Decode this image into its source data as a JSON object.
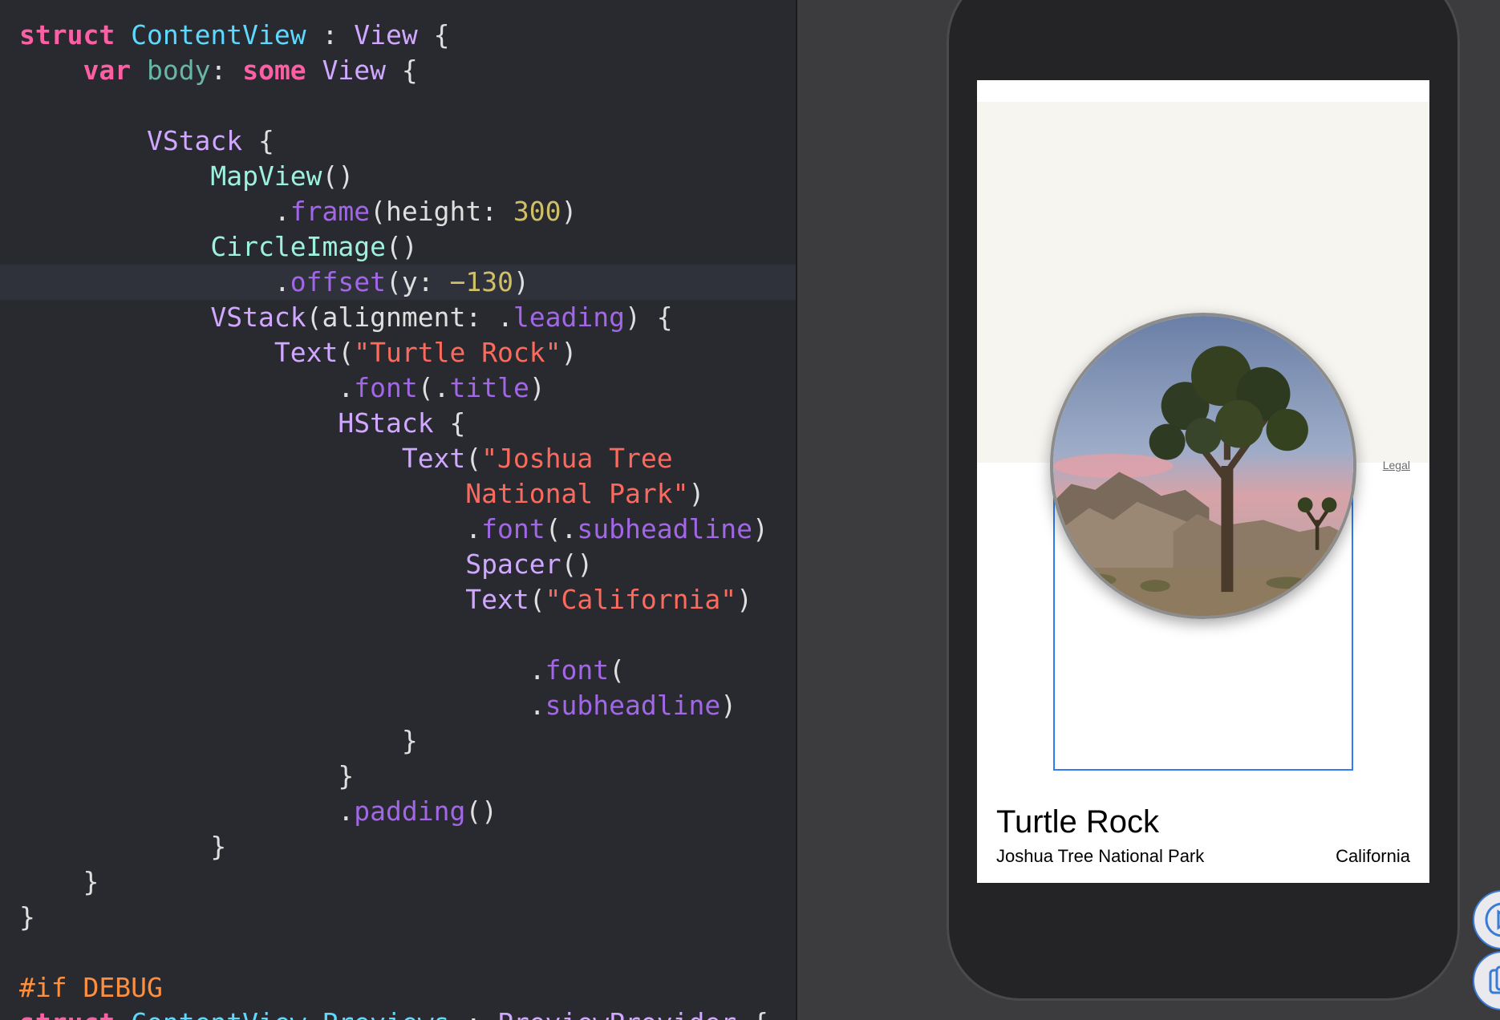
{
  "editor": {
    "lines": [
      [
        {
          "t": "kw",
          "v": "struct"
        },
        {
          "t": "plain",
          "v": " "
        },
        {
          "t": "type",
          "v": "ContentView"
        },
        {
          "t": "plain",
          "v": " : "
        },
        {
          "t": "sys",
          "v": "View"
        },
        {
          "t": "plain",
          "v": " {"
        }
      ],
      [
        {
          "t": "plain",
          "v": "    "
        },
        {
          "t": "kw",
          "v": "var"
        },
        {
          "t": "plain",
          "v": " "
        },
        {
          "t": "var",
          "v": "body"
        },
        {
          "t": "plain",
          "v": ": "
        },
        {
          "t": "kw",
          "v": "some"
        },
        {
          "t": "plain",
          "v": " "
        },
        {
          "t": "sys",
          "v": "View"
        },
        {
          "t": "plain",
          "v": " {"
        }
      ],
      [
        {
          "t": "plain",
          "v": ""
        }
      ],
      [
        {
          "t": "plain",
          "v": "        "
        },
        {
          "t": "sys",
          "v": "VStack"
        },
        {
          "t": "plain",
          "v": " {"
        }
      ],
      [
        {
          "t": "plain",
          "v": "            "
        },
        {
          "t": "fn",
          "v": "MapView"
        },
        {
          "t": "plain",
          "v": "()"
        }
      ],
      [
        {
          "t": "plain",
          "v": "                ."
        },
        {
          "t": "prop",
          "v": "frame"
        },
        {
          "t": "plain",
          "v": "(height: "
        },
        {
          "t": "num",
          "v": "300"
        },
        {
          "t": "plain",
          "v": ")"
        }
      ],
      [
        {
          "t": "plain",
          "v": "            "
        },
        {
          "t": "fn",
          "v": "CircleImage"
        },
        {
          "t": "plain",
          "v": "()"
        }
      ],
      [
        {
          "t": "plain",
          "v": "                ."
        },
        {
          "t": "prop",
          "v": "offset"
        },
        {
          "t": "plain",
          "v": "(y: "
        },
        {
          "t": "num",
          "v": "−130"
        },
        {
          "t": "plain",
          "v": ")"
        }
      ],
      [
        {
          "t": "plain",
          "v": "            "
        },
        {
          "t": "sys",
          "v": "VStack"
        },
        {
          "t": "plain",
          "v": "(alignment: ."
        },
        {
          "t": "prop",
          "v": "leading"
        },
        {
          "t": "plain",
          "v": ") {"
        }
      ],
      [
        {
          "t": "plain",
          "v": "                "
        },
        {
          "t": "sys",
          "v": "Text"
        },
        {
          "t": "plain",
          "v": "("
        },
        {
          "t": "str",
          "v": "\"Turtle Rock\""
        },
        {
          "t": "plain",
          "v": ")"
        }
      ],
      [
        {
          "t": "plain",
          "v": "                    ."
        },
        {
          "t": "prop",
          "v": "font"
        },
        {
          "t": "plain",
          "v": "(."
        },
        {
          "t": "prop",
          "v": "title"
        },
        {
          "t": "plain",
          "v": ")"
        }
      ],
      [
        {
          "t": "plain",
          "v": "                    "
        },
        {
          "t": "sys",
          "v": "HStack"
        },
        {
          "t": "plain",
          "v": " {"
        }
      ],
      [
        {
          "t": "plain",
          "v": "                        "
        },
        {
          "t": "sys",
          "v": "Text"
        },
        {
          "t": "plain",
          "v": "("
        },
        {
          "t": "str",
          "v": "\"Joshua Tree"
        }
      ],
      [
        {
          "t": "plain",
          "v": "                            "
        },
        {
          "t": "str",
          "v": "National Park\""
        },
        {
          "t": "plain",
          "v": ")"
        }
      ],
      [
        {
          "t": "plain",
          "v": "                            ."
        },
        {
          "t": "prop",
          "v": "font"
        },
        {
          "t": "plain",
          "v": "(."
        },
        {
          "t": "prop",
          "v": "subheadline"
        },
        {
          "t": "plain",
          "v": ")"
        }
      ],
      [
        {
          "t": "plain",
          "v": "                            "
        },
        {
          "t": "sys",
          "v": "Spacer"
        },
        {
          "t": "plain",
          "v": "()"
        }
      ],
      [
        {
          "t": "plain",
          "v": "                            "
        },
        {
          "t": "sys",
          "v": "Text"
        },
        {
          "t": "plain",
          "v": "("
        },
        {
          "t": "str",
          "v": "\"California\""
        },
        {
          "t": "plain",
          "v": ")"
        }
      ],
      [
        {
          "t": "plain",
          "v": ""
        }
      ],
      [
        {
          "t": "plain",
          "v": "                                ."
        },
        {
          "t": "prop",
          "v": "font"
        },
        {
          "t": "plain",
          "v": "("
        }
      ],
      [
        {
          "t": "plain",
          "v": "                                ."
        },
        {
          "t": "prop",
          "v": "subheadline"
        },
        {
          "t": "plain",
          "v": ")"
        }
      ],
      [
        {
          "t": "plain",
          "v": "                        }"
        }
      ],
      [
        {
          "t": "plain",
          "v": "                    }"
        }
      ],
      [
        {
          "t": "plain",
          "v": "                    ."
        },
        {
          "t": "prop",
          "v": "padding"
        },
        {
          "t": "plain",
          "v": "()"
        }
      ],
      [
        {
          "t": "plain",
          "v": "            }"
        }
      ],
      [
        {
          "t": "plain",
          "v": "    }"
        }
      ],
      [
        {
          "t": "plain",
          "v": "}"
        }
      ],
      [
        {
          "t": "plain",
          "v": ""
        }
      ],
      [
        {
          "t": "pre",
          "v": "#if DEBUG"
        }
      ],
      [
        {
          "t": "kw",
          "v": "struct"
        },
        {
          "t": "plain",
          "v": " "
        },
        {
          "t": "type",
          "v": "ContentView_Previews"
        },
        {
          "t": "plain",
          "v": " : "
        },
        {
          "t": "sys",
          "v": "PreviewProvider"
        },
        {
          "t": "plain",
          "v": " {"
        }
      ]
    ]
  },
  "preview": {
    "map_legal": "Legal",
    "title": "Turtle Rock",
    "park": "Joshua Tree National Park",
    "state": "California"
  },
  "icons": {
    "live_preview": "play-circle-icon",
    "duplicate_preview": "duplicate-icon"
  },
  "colors": {
    "editor_bg": "#292a30",
    "keyword": "#fc5fa3",
    "type": "#5dd8ff",
    "string": "#fc6a5d",
    "number": "#d0bf69",
    "selection": "#2f7cf6"
  }
}
